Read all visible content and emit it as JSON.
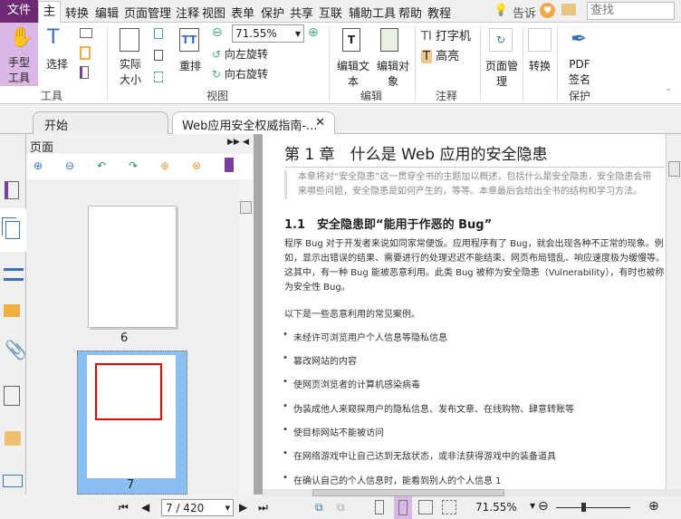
{
  "menu": {
    "file": "文件",
    "home": "主页",
    "items": [
      "转换",
      "编辑",
      "页面管理",
      "注释",
      "视图",
      "表单",
      "保护",
      "共享",
      "互联",
      "辅助工具",
      "帮助",
      "教程"
    ],
    "tell": "告诉",
    "search_placeholder": "查找"
  },
  "ribbon": {
    "hand": "手型工具",
    "select": "选择",
    "actual": "实际大小",
    "reflow": "重排",
    "zoom": "71.55%",
    "rotate_left": "向左旋转",
    "rotate_right": "向右旋转",
    "edit_text": "编辑文本",
    "edit_object": "编辑对象",
    "typewriter": "打字机",
    "highlight": "高亮",
    "page_manage": "页面管理",
    "convert": "转换",
    "pdf_sign": "PDF签名",
    "groups": {
      "tools": "工具",
      "view": "视图",
      "edit": "编辑",
      "comment": "注释",
      "protect": "保护"
    }
  },
  "tabs": [
    {
      "label": "开始"
    },
    {
      "label": "Web应用安全权威指南-..."
    }
  ],
  "panel": {
    "title": "页面",
    "thumbs": [
      {
        "page": "6"
      },
      {
        "page": "7"
      }
    ]
  },
  "doc": {
    "title": "第 1 章　什么是 Web 应用的安全隐患",
    "intro": "本章将对“安全隐患”这一贯穿全书的主题加以概述，包括什么是安全隐患，安全隐患会带来哪些问题，安全隐患是如何产生的，等等。本章最后会给出全书的结构和学习方法。",
    "h2": "1.1　安全隐患即“能用于作恶的 Bug”",
    "para": "程序 Bug 对于开发者来说如同家常便饭。应用程序有了 Bug，就会出现各种不正常的现象。例如，显示出错误的结果、需要进行的处理迟迟不能结束、网页布局错乱、响应速度极为缓慢等。这其中，有一种 Bug 能被恶意利用。此类 Bug 被称为安全隐患（Vulnerability），有时也被称为安全性 Bug。",
    "lead": "以下是一些恶意利用的常见案例。",
    "bullets": [
      "未经许可浏览用户个人信息等隐私信息",
      "篡改网站的内容",
      "使网页浏览者的计算机感染病毒",
      "伪装成他人来窥探用户的隐私信息、发布文章、在线购物、肆意转账等",
      "使目标网站不能被访问",
      "在网络游戏中让自己达到无敌状态，或非法获得游戏中的装备道具",
      "在确认自己的个人信息时，能看到别人的个人信息 1"
    ]
  },
  "status": {
    "page": "7 / 420",
    "zoom": "71.55%",
    "zoom_fraction": 0.36
  },
  "colors": {
    "file": "#6c2a72",
    "hand_bg": "#d9b8e6",
    "selected_thumb": "#8bbff2",
    "accent": "#3d6fb6"
  }
}
